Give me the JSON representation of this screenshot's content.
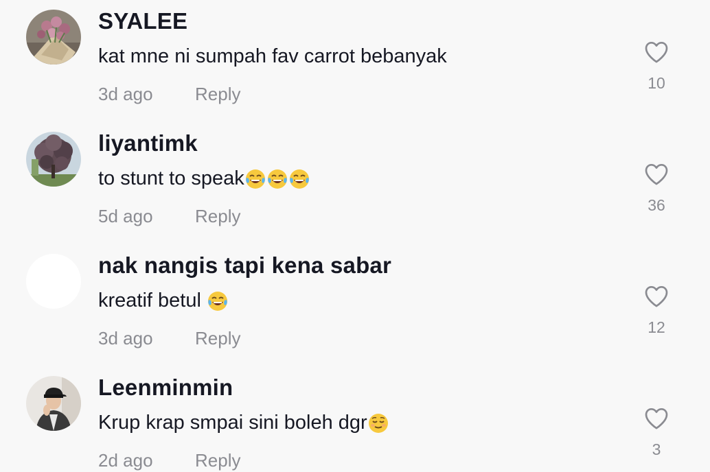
{
  "comments": [
    {
      "username": "SYALEE",
      "text": "kat mne ni sumpah fav carrot bebanyak",
      "emojis": [],
      "time": "3d ago",
      "reply_label": "Reply",
      "likes": "10",
      "avatar": "tulip-bouquet-photo"
    },
    {
      "username": "liyantimk",
      "text": "to stunt to speak",
      "emojis": [
        "tears-of-joy-emoji",
        "tears-of-joy-emoji",
        "tears-of-joy-emoji"
      ],
      "time": "5d ago",
      "reply_label": "Reply",
      "likes": "36",
      "avatar": "tree-photo"
    },
    {
      "username": "nak nangis tapi kena sabar",
      "text": "kreatif betul ",
      "emojis": [
        "tears-of-joy-emoji"
      ],
      "time": "3d ago",
      "reply_label": "Reply",
      "likes": "12",
      "avatar": "blank-white"
    },
    {
      "username": "Leenminmin",
      "text": "Krup krap smpai sini boleh dgr",
      "emojis": [
        "relieved-face-emoji"
      ],
      "time": "2d ago",
      "reply_label": "Reply",
      "likes": "3",
      "avatar": "person-in-cap-photo"
    }
  ],
  "colors": {
    "background": "#f8f8f8",
    "primary_text": "#161823",
    "secondary_text": "#8a8b91",
    "heart_outline": "#8a8b91"
  }
}
